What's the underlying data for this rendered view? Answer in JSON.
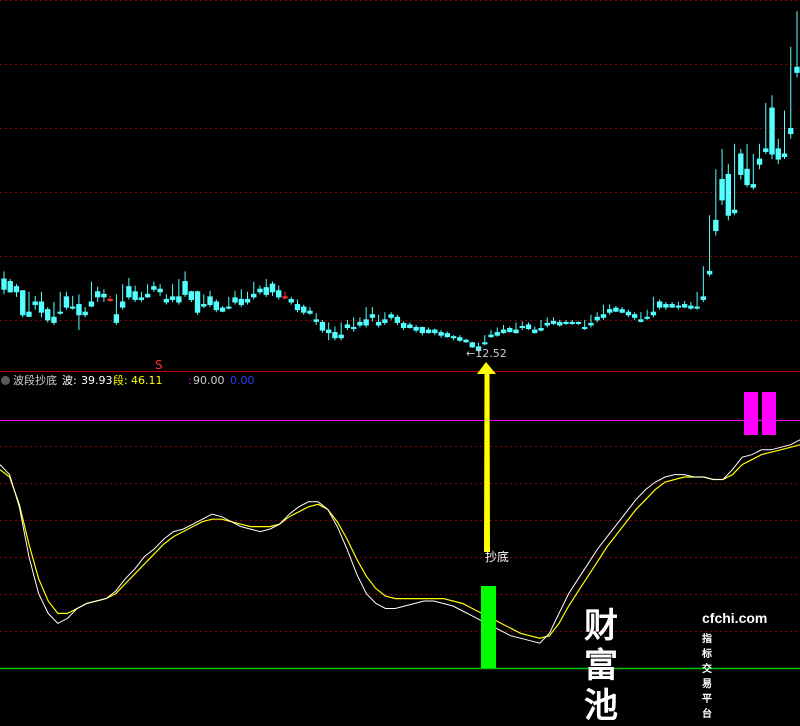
{
  "colors": {
    "up": "#ff3232",
    "down": "#54ffff",
    "grid": "#8b0000",
    "wave_line": "#ffffff",
    "segment_line": "#ffff00",
    "signal_top": "#ff00ff",
    "signal_bottom": "#00ff00",
    "arrow": "#ffff00",
    "level_line": "#ff00ff",
    "baseline": "#00c800"
  },
  "price_panel": {
    "top_marker": "S",
    "low_annotation": "12.52",
    "candles": [
      [
        11.95,
        12.1,
        11.75,
        11.65
      ],
      [
        11.9,
        11.95,
        11.7,
        11.68
      ],
      [
        11.8,
        11.85,
        11.7,
        11.6
      ],
      [
        11.72,
        11.72,
        11.25,
        11.2
      ],
      [
        11.3,
        11.7,
        11.22,
        11.2
      ],
      [
        11.5,
        11.62,
        11.45,
        11.35
      ],
      [
        11.5,
        11.7,
        11.3,
        11.2
      ],
      [
        11.35,
        11.4,
        11.15,
        11.1
      ],
      [
        11.2,
        11.5,
        11.1,
        11.05
      ],
      [
        11.3,
        11.7,
        11.28,
        11.25
      ],
      [
        11.6,
        11.7,
        11.4,
        11.35
      ],
      [
        11.4,
        11.62,
        11.38,
        11.35
      ],
      [
        11.45,
        11.65,
        11.25,
        10.95
      ],
      [
        11.3,
        11.4,
        11.25,
        11.2
      ],
      [
        11.5,
        11.9,
        11.42,
        11.4
      ],
      [
        11.7,
        11.8,
        11.6,
        11.5
      ],
      [
        11.65,
        11.75,
        11.6,
        11.5
      ],
      [
        11.55,
        11.62,
        11.55,
        11.5
      ],
      [
        11.25,
        11.65,
        11.1,
        11.05
      ],
      [
        11.5,
        11.85,
        11.4,
        11.35
      ],
      [
        11.8,
        11.97,
        11.6,
        11.55
      ],
      [
        11.7,
        11.82,
        11.55,
        11.5
      ],
      [
        11.58,
        11.7,
        11.55,
        11.5
      ],
      [
        11.65,
        11.85,
        11.6,
        11.58
      ],
      [
        11.8,
        11.9,
        11.75,
        11.7
      ],
      [
        11.75,
        11.85,
        11.7,
        11.62
      ],
      [
        11.55,
        11.65,
        11.5,
        11.45
      ],
      [
        11.6,
        11.85,
        11.55,
        11.5
      ],
      [
        11.6,
        11.95,
        11.5,
        11.45
      ],
      [
        11.9,
        12.1,
        11.65,
        11.6
      ],
      [
        11.7,
        11.72,
        11.55,
        11.5
      ],
      [
        11.7,
        11.72,
        11.3,
        11.25
      ],
      [
        11.45,
        11.65,
        11.42,
        11.38
      ],
      [
        11.6,
        11.72,
        11.45,
        11.4
      ],
      [
        11.5,
        11.55,
        11.35,
        11.3
      ],
      [
        11.38,
        11.42,
        11.32,
        11.3
      ],
      [
        11.4,
        11.6,
        11.38,
        11.35
      ],
      [
        11.58,
        11.72,
        11.5,
        11.45
      ],
      [
        11.55,
        11.75,
        11.45,
        11.4
      ],
      [
        11.55,
        11.7,
        11.5,
        11.45
      ],
      [
        11.65,
        11.9,
        11.6,
        11.55
      ],
      [
        11.75,
        11.82,
        11.7,
        11.65
      ],
      [
        11.78,
        11.95,
        11.65,
        11.6
      ],
      [
        11.85,
        11.9,
        11.7,
        11.62
      ],
      [
        11.72,
        11.82,
        11.6,
        11.55
      ],
      [
        11.6,
        11.7,
        11.6,
        11.55
      ],
      [
        11.55,
        11.6,
        11.5,
        11.45
      ],
      [
        11.45,
        11.55,
        11.35,
        11.3
      ],
      [
        11.4,
        11.45,
        11.3,
        11.25
      ],
      [
        11.32,
        11.4,
        11.28,
        11.25
      ],
      [
        11.15,
        11.28,
        11.12,
        11.05
      ],
      [
        11.1,
        11.15,
        10.95,
        10.9
      ],
      [
        10.95,
        11.1,
        10.9,
        10.75
      ],
      [
        10.9,
        11.02,
        10.8,
        10.75
      ],
      [
        10.85,
        11.1,
        10.8,
        10.75
      ],
      [
        11.05,
        11.15,
        11.0,
        10.95
      ],
      [
        11.0,
        11.2,
        10.98,
        10.92
      ],
      [
        11.1,
        11.2,
        11.05,
        11.0
      ],
      [
        11.15,
        11.4,
        11.05,
        11.0
      ],
      [
        11.25,
        11.4,
        11.2,
        11.12
      ],
      [
        11.1,
        11.25,
        11.05,
        11.0
      ],
      [
        11.15,
        11.3,
        11.1,
        11.05
      ],
      [
        11.25,
        11.3,
        11.2,
        11.15
      ],
      [
        11.2,
        11.25,
        11.1,
        11.05
      ],
      [
        11.08,
        11.12,
        11.0,
        10.95
      ],
      [
        11.05,
        11.1,
        11.0,
        10.98
      ],
      [
        11.0,
        11.05,
        10.95,
        10.9
      ],
      [
        11.0,
        11.02,
        10.9,
        10.85
      ],
      [
        10.95,
        11.0,
        10.9,
        10.88
      ],
      [
        10.95,
        10.98,
        10.9,
        10.85
      ],
      [
        10.9,
        10.95,
        10.85,
        10.8
      ],
      [
        10.88,
        10.92,
        10.82,
        10.8
      ],
      [
        10.82,
        10.85,
        10.8,
        10.75
      ],
      [
        10.8,
        10.85,
        10.75,
        10.72
      ],
      [
        10.75,
        10.78,
        10.72,
        10.7
      ],
      [
        10.7,
        10.72,
        10.62,
        10.6
      ],
      [
        10.62,
        10.7,
        10.55,
        10.52
      ],
      [
        10.7,
        10.85,
        10.68,
        10.65
      ],
      [
        10.85,
        10.95,
        10.82,
        10.8
      ],
      [
        10.9,
        11.0,
        10.85,
        10.82
      ],
      [
        10.95,
        11.05,
        10.9,
        10.88
      ],
      [
        10.98,
        11.02,
        10.92,
        10.9
      ],
      [
        10.95,
        11.1,
        10.9,
        10.88
      ],
      [
        11.02,
        11.12,
        11.0,
        10.95
      ],
      [
        11.05,
        11.1,
        10.98,
        10.95
      ],
      [
        10.95,
        11.02,
        10.9,
        10.88
      ],
      [
        10.98,
        11.15,
        10.95,
        10.92
      ],
      [
        11.08,
        11.2,
        11.05,
        11.0
      ],
      [
        11.12,
        11.2,
        11.08,
        11.05
      ],
      [
        11.1,
        11.15,
        11.05,
        11.02
      ],
      [
        11.1,
        11.15,
        11.08,
        11.05
      ],
      [
        11.1,
        11.15,
        11.08,
        11.05
      ],
      [
        11.1,
        11.12,
        11.08,
        11.05
      ],
      [
        11.0,
        11.15,
        10.98,
        10.95
      ],
      [
        11.08,
        11.25,
        11.05,
        11.0
      ],
      [
        11.2,
        11.3,
        11.15,
        11.1
      ],
      [
        11.25,
        11.45,
        11.2,
        11.15
      ],
      [
        11.35,
        11.45,
        11.3,
        11.25
      ],
      [
        11.38,
        11.42,
        11.32,
        11.3
      ],
      [
        11.35,
        11.4,
        11.3,
        11.28
      ],
      [
        11.3,
        11.35,
        11.25,
        11.2
      ],
      [
        11.25,
        11.3,
        11.2,
        11.15
      ],
      [
        11.15,
        11.3,
        11.12,
        11.1
      ],
      [
        11.2,
        11.35,
        11.18,
        11.15
      ],
      [
        11.3,
        11.6,
        11.25,
        11.2
      ],
      [
        11.5,
        11.55,
        11.4,
        11.35
      ],
      [
        11.45,
        11.5,
        11.4,
        11.35
      ],
      [
        11.45,
        11.5,
        11.4,
        11.38
      ],
      [
        11.42,
        11.5,
        11.4,
        11.35
      ],
      [
        11.45,
        11.52,
        11.4,
        11.38
      ],
      [
        11.42,
        11.5,
        11.38,
        11.35
      ],
      [
        11.4,
        11.7,
        11.38,
        11.35
      ],
      [
        11.6,
        12.2,
        11.55,
        11.5
      ],
      [
        12.1,
        13.2,
        12.05,
        12.0
      ],
      [
        13.1,
        14.1,
        12.9,
        12.8
      ],
      [
        13.9,
        14.5,
        13.5,
        13.4
      ],
      [
        14.0,
        14.2,
        13.2,
        13.1
      ],
      [
        13.3,
        14.6,
        13.25,
        13.2
      ],
      [
        14.4,
        14.5,
        14.0,
        13.9
      ],
      [
        14.1,
        14.6,
        13.8,
        13.75
      ],
      [
        13.8,
        14.4,
        13.75,
        13.7
      ],
      [
        14.3,
        14.6,
        14.2,
        14.1
      ],
      [
        14.5,
        15.4,
        14.45,
        14.4
      ],
      [
        15.3,
        15.55,
        14.4,
        14.3
      ],
      [
        14.5,
        14.7,
        14.3,
        14.2
      ],
      [
        14.4,
        15.25,
        14.35,
        14.3
      ],
      [
        14.9,
        16.5,
        14.8,
        14.7
      ],
      [
        16.1,
        17.2,
        16.0,
        15.9
      ]
    ]
  },
  "indicator_panel": {
    "name": "波段抄底",
    "wave_label": "波:",
    "wave_value": "39.93",
    "segment_label": "段:",
    "segment_value": "46.11",
    "level_label": ":",
    "level_value": "90.00",
    "bottom_value": "0.00",
    "signal_text": "抄底",
    "ylim": [
      0,
      100
    ],
    "wave": [
      82,
      78,
      65,
      45,
      30,
      22,
      18,
      20,
      24,
      26,
      27,
      28,
      31,
      36,
      40,
      45,
      48,
      52,
      55,
      56,
      58,
      60,
      62,
      61,
      59,
      57,
      56,
      55,
      56,
      58,
      62,
      65,
      67,
      67,
      64,
      57,
      48,
      38,
      30,
      26,
      24,
      24,
      25,
      26,
      27,
      27,
      26,
      25,
      23,
      21,
      19,
      17,
      15,
      13,
      12,
      11,
      10,
      14,
      22,
      30,
      36,
      42,
      48,
      53,
      58,
      63,
      68,
      72,
      75,
      77,
      78,
      78,
      77,
      77,
      76,
      76,
      80,
      85,
      86,
      88,
      88,
      89,
      90,
      92
    ],
    "segment": [
      80,
      77,
      66,
      50,
      36,
      27,
      22,
      22,
      24,
      26,
      27,
      28,
      30,
      34,
      38,
      42,
      46,
      50,
      53,
      55,
      57,
      59,
      60,
      60,
      59,
      58,
      57,
      57,
      57,
      58,
      61,
      63,
      65,
      66,
      64,
      59,
      52,
      44,
      37,
      32,
      29,
      28,
      28,
      28,
      28,
      28,
      28,
      27,
      26,
      24,
      22,
      20,
      18,
      16,
      14,
      13,
      12,
      13,
      18,
      25,
      31,
      37,
      43,
      49,
      54,
      59,
      64,
      68,
      72,
      75,
      76,
      77,
      77,
      77,
      76,
      76,
      78,
      82,
      84,
      86,
      87,
      88,
      89,
      90
    ],
    "top_signals": [
      [
        744,
        758
      ],
      [
        762,
        776
      ]
    ],
    "bottom_signal": [
      481,
      496
    ]
  },
  "watermark": {
    "brand_cn": "财富池",
    "url": "cfchi.com",
    "tagline": "指标交易平台"
  }
}
